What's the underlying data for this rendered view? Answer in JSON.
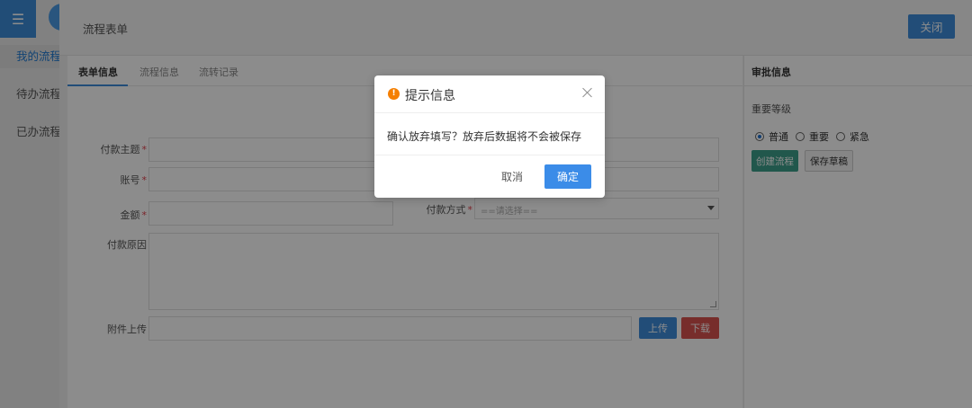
{
  "sidebar": {
    "menu_icon": "hamburger-icon",
    "items": [
      {
        "label": "我的流程"
      },
      {
        "label": "待办流程"
      },
      {
        "label": "已办流程"
      }
    ]
  },
  "header": {
    "title": "流程表单",
    "close_label": "关闭"
  },
  "tabs": [
    {
      "label": "表单信息"
    },
    {
      "label": "流程信息"
    },
    {
      "label": "流转记录"
    }
  ],
  "form": {
    "subject_label": "付款主题",
    "account_label": "账号",
    "amount_label": "金额",
    "method_label": "付款方式",
    "method_placeholder": "==请选择==",
    "reason_label": "付款原因",
    "attachment_label": "附件上传",
    "upload_label": "上传",
    "download_label": "下载",
    "required_mark": "*"
  },
  "approval": {
    "title": "审批信息",
    "level_label": "重要等级",
    "levels": [
      {
        "label": "普通",
        "checked": true
      },
      {
        "label": "重要",
        "checked": false
      },
      {
        "label": "紧急",
        "checked": false
      }
    ],
    "create_label": "创建流程",
    "save_draft_label": "保存草稿"
  },
  "dialog": {
    "title": "提示信息",
    "icon": "warning-icon",
    "message": "确认放弃填写？放弃后数据将不会被保存",
    "cancel_label": "取消",
    "confirm_label": "确定"
  },
  "colors": {
    "primary": "#3f8ddb",
    "success": "#3c9e8a",
    "danger": "#d9534f",
    "warning": "#f57f00",
    "required": "#e0414c"
  }
}
